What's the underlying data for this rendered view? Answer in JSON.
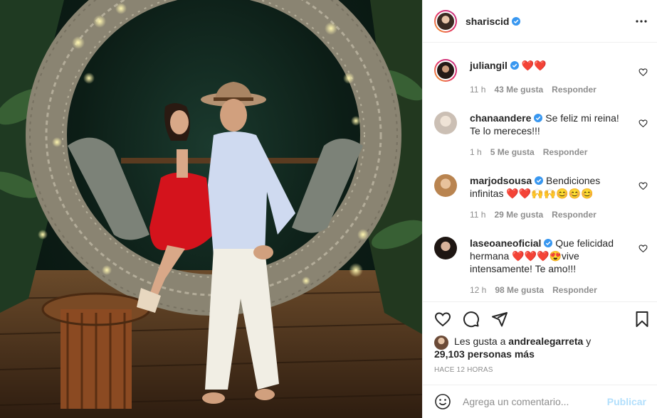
{
  "post": {
    "author": "shariscid",
    "author_verified": true,
    "photo_alt": ""
  },
  "comments": [
    {
      "user": "juliangil",
      "verified": true,
      "text": "❤️❤️",
      "time": "11 h",
      "likes": "43 Me gusta",
      "reply": "Responder"
    },
    {
      "user": "chanaandere",
      "verified": true,
      "text": "Se feliz mi reina! Te lo mereces!!!",
      "time": "1 h",
      "likes": "5 Me gusta",
      "reply": "Responder"
    },
    {
      "user": "marjodsousa",
      "verified": true,
      "text": "Bendiciones infinitas ❤️❤️🙌🙌😊😊😊",
      "time": "11 h",
      "likes": "29 Me gusta",
      "reply": "Responder"
    },
    {
      "user": "laseoaneoficial",
      "verified": true,
      "text": "Que felicidad hermana ❤️❤️❤️😍vive intensamente! Te amo!!!",
      "time": "12 h",
      "likes": "98 Me gusta",
      "reply": "Responder"
    }
  ],
  "liked_by": {
    "prefix": "Les gusta a",
    "user": "andrealegarreta",
    "conj": "y",
    "count": "29,103 personas más"
  },
  "timestamp": "HACE 12 HORAS",
  "comment_box": {
    "placeholder": "Agrega un comentario...",
    "publish_label": "Publicar"
  },
  "icons": {
    "more": "more-icon",
    "like": "heart-icon",
    "comment": "comment-icon",
    "share": "share-icon",
    "save": "bookmark-icon",
    "emoji": "smile-icon"
  },
  "colors": {
    "verified": "#3897f0",
    "heart": "#ed4956",
    "muted": "#8e8e8e",
    "publish": "#b2dffc"
  }
}
